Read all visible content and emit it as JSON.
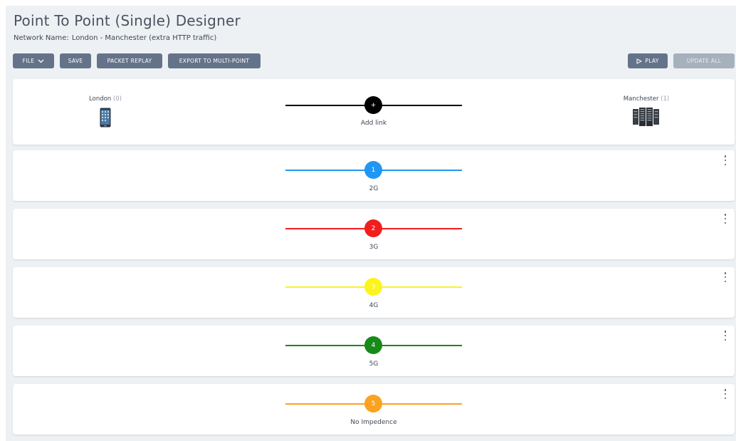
{
  "header": {
    "title": "Point To Point (Single) Designer",
    "network_label": "Network Name:",
    "network_name": "London - Manchester (extra HTTP traffic)"
  },
  "toolbar": {
    "file_label": "FILE",
    "save_label": "SAVE",
    "packet_replay_label": "PACKET REPLAY",
    "export_label": "EXPORT TO MULTI-POINT",
    "play_label": "PLAY",
    "update_all_label": "UPDATE ALL"
  },
  "endpoints": {
    "left": {
      "name": "London",
      "count": "(0)",
      "icon": "smartphone-icon"
    },
    "right": {
      "name": "Manchester",
      "count": "(1)",
      "icon": "server-icon"
    }
  },
  "add_link": {
    "symbol": "+",
    "label": "Add link"
  },
  "links": [
    {
      "number": "1",
      "label": "2G",
      "color": "#2196f3"
    },
    {
      "number": "2",
      "label": "3G",
      "color": "#f21d1d"
    },
    {
      "number": "3",
      "label": "4G",
      "color": "#fcf41a"
    },
    {
      "number": "4",
      "label": "5G",
      "color": "#178a17"
    },
    {
      "number": "5",
      "label": "No Impedence",
      "color": "#fba21e"
    }
  ],
  "colors": {
    "button": "#65738a",
    "button_disabled": "#a7b0bd",
    "background": "#eef1f4"
  }
}
